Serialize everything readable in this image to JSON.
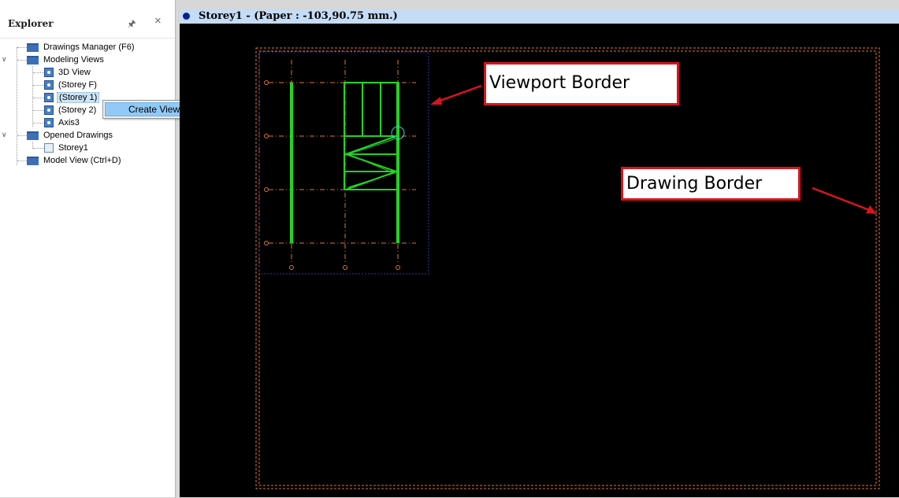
{
  "explorer": {
    "title": "Explorer",
    "pin_icon": "pin-icon",
    "close_icon": "close-icon",
    "tree": {
      "drawings_manager": "Drawings Manager (F6)",
      "modeling_views": "Modeling Views",
      "view_3d": "3D View",
      "storey_f": "(Storey F)",
      "storey_1": "(Storey 1)",
      "storey_2": "(Storey 2)",
      "axis3": "Axis3",
      "opened_drawings": "Opened Drawings",
      "storey1": "Storey1",
      "model_view": "Model View (Ctrl+D)"
    }
  },
  "context_menu": {
    "create_viewport": "Create Viewport"
  },
  "drawing_window": {
    "title": "Storey1 - (Paper : -103,90.75 mm.)"
  },
  "annotations": {
    "viewport_border": "Viewport Border",
    "drawing_border": "Drawing Border"
  },
  "colors": {
    "canvas_bg": "#000000",
    "stair_green": "#22d322",
    "axis_orange": "#e0743a",
    "viewport_blue": "#2b3ab8",
    "callout_red": "#d8141b"
  }
}
